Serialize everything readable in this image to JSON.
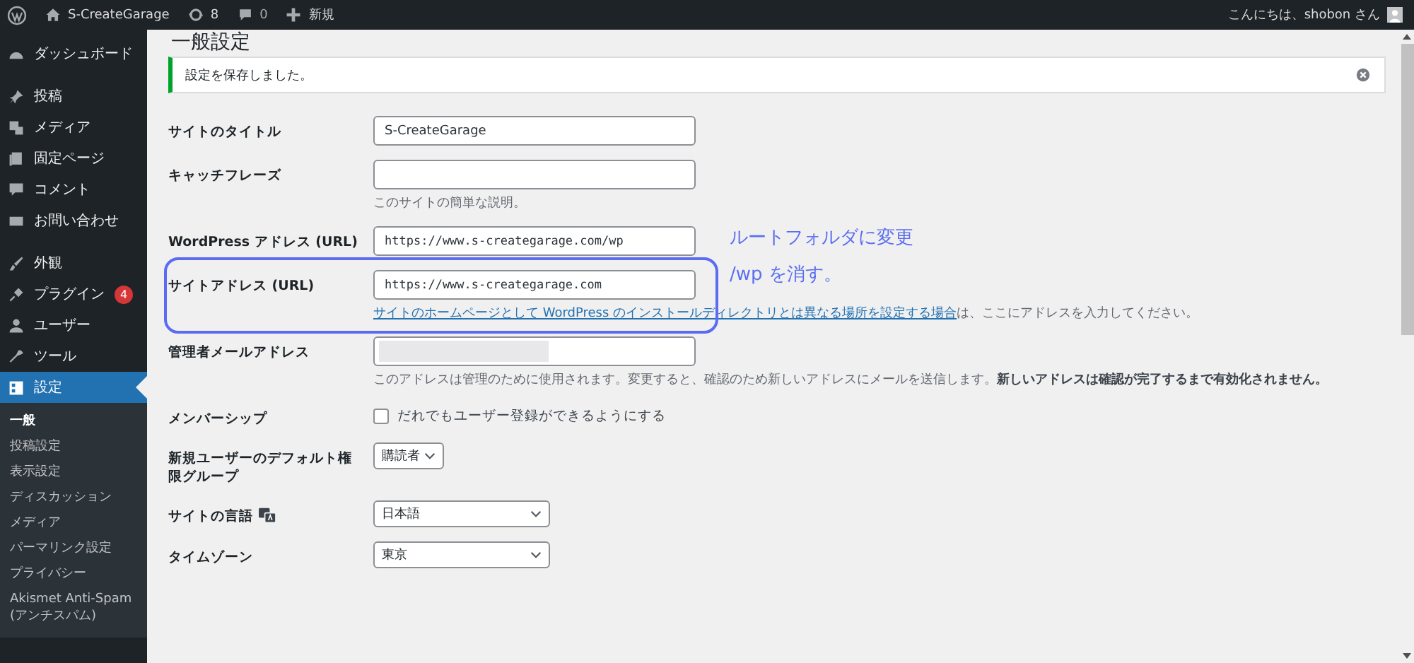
{
  "toolbar": {
    "site_name": "S-CreateGarage",
    "updates": "8",
    "comments": "0",
    "new_label": "新規",
    "greeting": "こんにちは、shobon さん"
  },
  "sidebar": {
    "groups": [
      [
        {
          "label": "ダッシュボード",
          "selected": false
        }
      ],
      [
        {
          "label": "投稿",
          "selected": false
        },
        {
          "label": "メディア",
          "selected": false
        },
        {
          "label": "固定ページ",
          "selected": false
        },
        {
          "label": "コメント",
          "selected": false
        },
        {
          "label": "お問い合わせ",
          "selected": false
        }
      ],
      [
        {
          "label": "外観",
          "selected": false
        },
        {
          "label": "プラグイン",
          "badge": "4",
          "selected": false
        },
        {
          "label": "ユーザー",
          "selected": false
        },
        {
          "label": "ツール",
          "selected": false
        },
        {
          "label": "設定",
          "selected": true,
          "children": [
            {
              "label": "一般",
              "selected": true
            },
            {
              "label": "投稿設定",
              "selected": false
            },
            {
              "label": "表示設定",
              "selected": false
            },
            {
              "label": "ディスカッション",
              "selected": false
            },
            {
              "label": "メディア",
              "selected": false
            },
            {
              "label": "パーマリンク設定",
              "selected": false
            },
            {
              "label": "プライバシー",
              "selected": false
            },
            {
              "label": "Akismet Anti-Spam (アンチスパム)",
              "selected": false
            }
          ]
        }
      ]
    ]
  },
  "page": {
    "title": "一般設定",
    "notice": "設定を保存しました。"
  },
  "fields": [
    {
      "kind": "text",
      "label": "サイトのタイトル",
      "value": "S-CreateGarage"
    },
    {
      "kind": "text",
      "label": "キャッチフレーズ",
      "description": "このサイトの簡単な説明。"
    },
    {
      "kind": "url",
      "label": "WordPress アドレス (URL)",
      "value": "https://www.s-creategarage.com/wp"
    },
    {
      "kind": "url",
      "label": "サイトアドレス (URL)",
      "value": "https://www.s-creategarage.com",
      "highlighted": true,
      "description_link": "サイトのホームページとして WordPress のインストールディレクトリとは異なる場所を設定する場合",
      "description": "は、ここにアドレスを入力してください。"
    },
    {
      "kind": "redacted",
      "label": "管理者メールアドレス",
      "description": "このアドレスは管理のために使用されます。変更すると、確認のため新しいアドレスにメールを送信します。**新しいアドレスは確認が完了するまで有効化されません。**"
    },
    {
      "kind": "checkbox",
      "label": "メンバーシップ",
      "option": "だれでもユーザー登録ができるようにする",
      "checked": false
    },
    {
      "kind": "select",
      "label": "新規ユーザーのデフォルト権限グループ",
      "value": "購読者",
      "wide": false
    },
    {
      "kind": "select",
      "label": "サイトの言語",
      "value": "日本語",
      "wide": true,
      "translate_icon": true
    },
    {
      "kind": "select",
      "label": "タイムゾーン",
      "value": "東京",
      "wide": true
    }
  ],
  "annotation": {
    "lines": [
      "ルートフォルダに変更",
      "/wp を消す。"
    ]
  }
}
